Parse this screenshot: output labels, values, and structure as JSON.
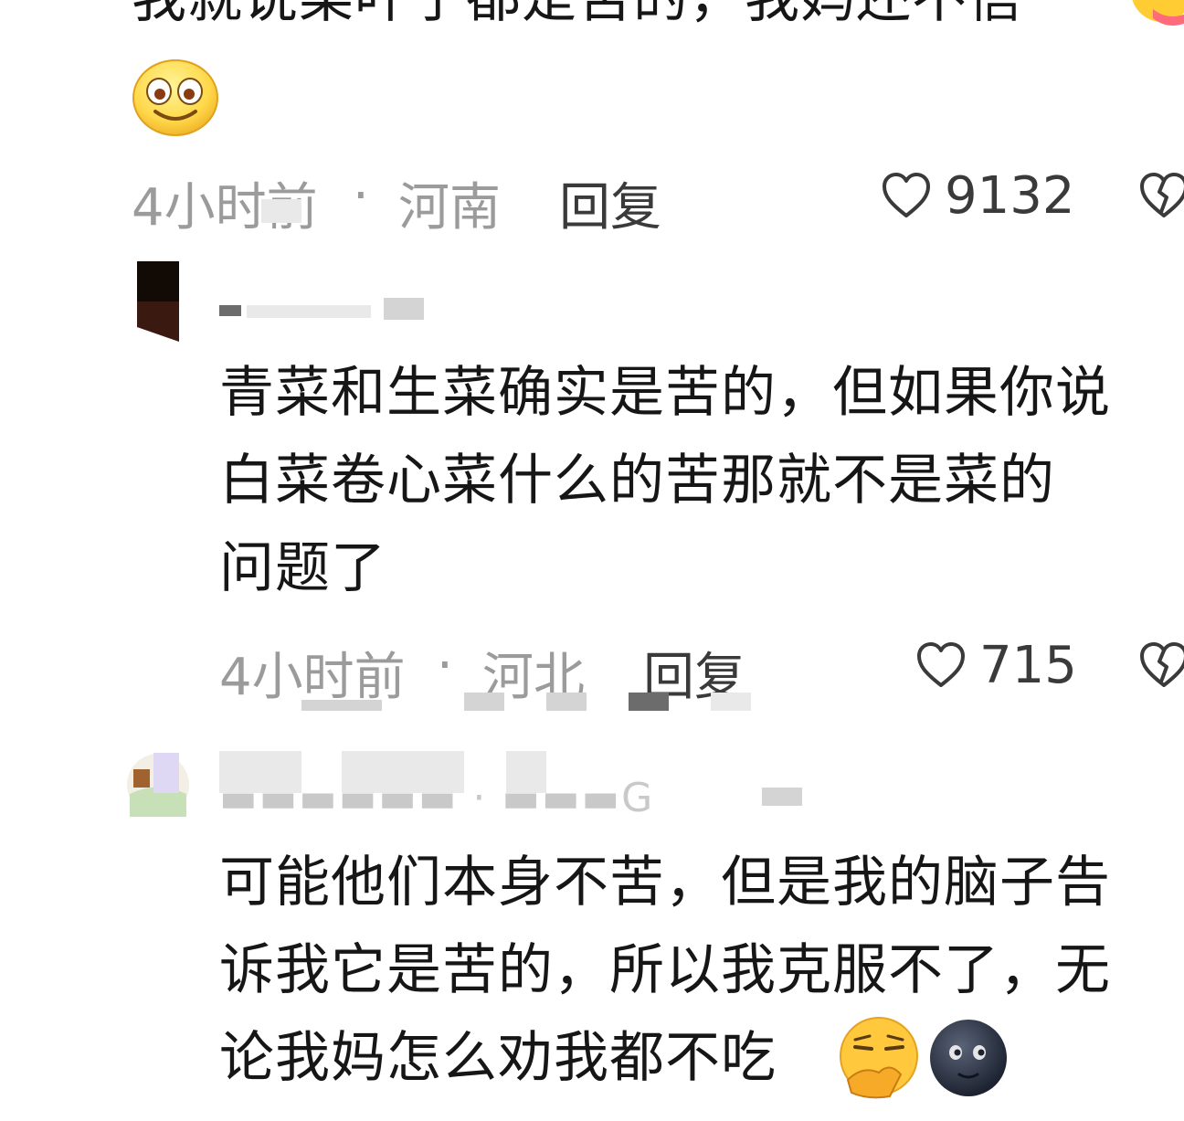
{
  "comments": [
    {
      "text_lines": [
        "我就说菜叶子都是苦的，我妈还不信"
      ],
      "time": "4小时前",
      "location": "河南",
      "reply_label": "回复",
      "like_count": "9132"
    },
    {
      "text_lines": [
        "青菜和生菜确实是苦的，但如果你说",
        "白菜卷心菜什么的苦那就不是菜的",
        "问题了"
      ],
      "time": "4小时前",
      "location": "河北",
      "reply_label": "回复",
      "like_count": "715"
    },
    {
      "text_lines": [
        "可能他们本身不苦，但是我的脑子告",
        "诉我它是苦的，所以我克服不了，无",
        "论我妈怎么劝我都不吃"
      ],
      "emoji": [
        "🤭",
        "🌚"
      ]
    }
  ],
  "meta_separator": "·",
  "icons": {
    "like": "heart-outline-icon",
    "dislike": "broken-heart-icon",
    "emoji": "smiley-emoji-icon"
  },
  "colors": {
    "text": "#161616",
    "meta": "#9b9b9b",
    "action": "#3a3a3a"
  }
}
